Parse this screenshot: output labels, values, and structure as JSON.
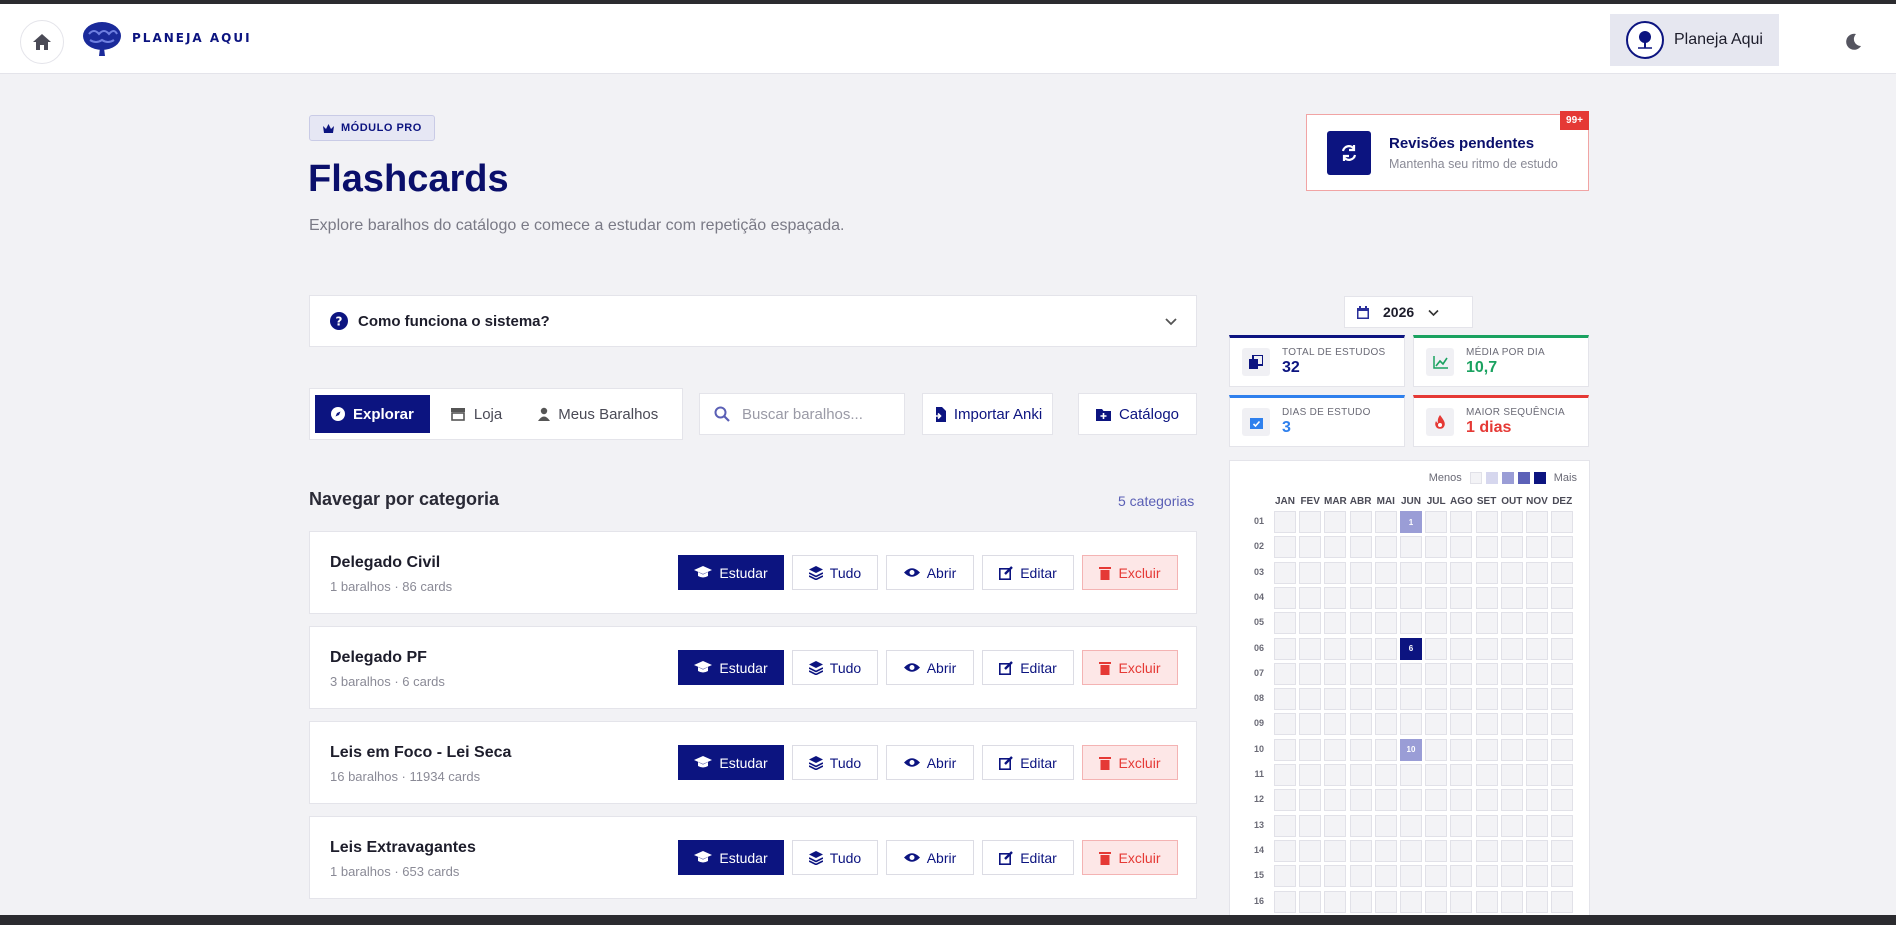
{
  "header": {
    "logo_text": "PLANEJA AQUI",
    "user_name": "Planeja Aqui"
  },
  "hero": {
    "badge": "MÓDULO PRO",
    "title": "Flashcards",
    "subtitle": "Explore baralhos do catálogo e comece a estudar com repetição espaçada."
  },
  "reviews": {
    "title": "Revisões pendentes",
    "subtitle": "Mantenha seu ritmo de estudo",
    "count_badge": "99+"
  },
  "faq": {
    "label": "Como funciona o sistema?"
  },
  "tabs": [
    {
      "label": "Explorar",
      "icon": "compass-icon",
      "active": true
    },
    {
      "label": "Loja",
      "icon": "store-icon",
      "active": false
    },
    {
      "label": "Meus Baralhos",
      "icon": "user-icon",
      "active": false
    }
  ],
  "search": {
    "placeholder": "Buscar baralhos..."
  },
  "actions": {
    "import_label": "Importar Anki",
    "catalog_label": "Catálogo"
  },
  "section": {
    "title": "Navegar por categoria",
    "count": "5 categorias"
  },
  "category_buttons": {
    "study": "Estudar",
    "all": "Tudo",
    "open": "Abrir",
    "edit": "Editar",
    "delete": "Excluir"
  },
  "categories": [
    {
      "name": "Delegado Civil",
      "meta": "1 baralhos · 86 cards"
    },
    {
      "name": "Delegado PF",
      "meta": "3 baralhos · 6 cards"
    },
    {
      "name": "Leis em Foco - Lei Seca",
      "meta": "16 baralhos · 11934 cards"
    },
    {
      "name": "Leis Extravagantes",
      "meta": "1 baralhos · 653 cards"
    }
  ],
  "year": "2026",
  "stats": [
    {
      "label": "TOTAL DE ESTUDOS",
      "value": "32",
      "color": "#0c1480",
      "icon": "cards-icon"
    },
    {
      "label": "MÉDIA POR DIA",
      "value": "10,7",
      "color": "#1aa260",
      "icon": "chart-line-icon"
    },
    {
      "label": "DIAS DE ESTUDO",
      "value": "3",
      "color": "#2f80ed",
      "icon": "calendar-check-icon"
    },
    {
      "label": "MAIOR SEQUÊNCIA",
      "value": "1 dias",
      "color": "#e53935",
      "icon": "fire-icon"
    }
  ],
  "heatmap": {
    "legend_less": "Menos",
    "legend_more": "Mais",
    "months": [
      "JAN",
      "FEV",
      "MAR",
      "ABR",
      "MAI",
      "JUN",
      "JUL",
      "AGO",
      "SET",
      "OUT",
      "NOV",
      "DEZ"
    ],
    "days": [
      "01",
      "02",
      "03",
      "04",
      "05",
      "06",
      "07",
      "08",
      "09",
      "10",
      "11",
      "12",
      "13",
      "14",
      "15",
      "16"
    ],
    "active": [
      {
        "month": "JUN",
        "day": "01",
        "label": "1",
        "level": 2
      },
      {
        "month": "JUN",
        "day": "06",
        "label": "6",
        "level": 4
      },
      {
        "month": "JUN",
        "day": "10",
        "label": "10",
        "level": 2
      }
    ],
    "level_colors": [
      "#f3f3f6",
      "#d6d7ee",
      "#9a9dd6",
      "#5c61b8",
      "#0c1480"
    ]
  }
}
